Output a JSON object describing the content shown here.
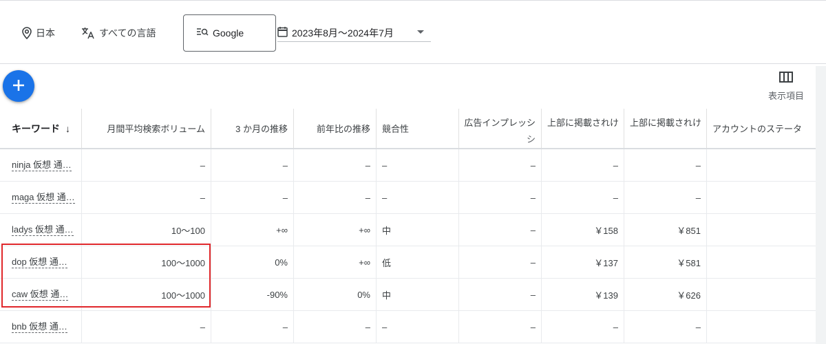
{
  "filters": {
    "location_icon": "location-pin-icon",
    "location": "日本",
    "language_icon": "translate-icon",
    "language": "すべての言語",
    "engine_icon": "search-engine-icon",
    "engine": "Google",
    "date_icon": "calendar-icon",
    "date_range": "2023年8月～2024年7月"
  },
  "toolbar": {
    "add_icon": "plus-icon",
    "columns_icon": "columns-icon",
    "columns_label": "表示項目"
  },
  "table": {
    "headers": {
      "keyword": "キーワード",
      "sort_arrow": "↓",
      "volume": "月間平均検索ボリューム",
      "trend3m": "3 か月の推移",
      "yoy": "前年比の推移",
      "competition": "競合性",
      "impression_share": "広告インプレッシ",
      "impression_share_cont": "シ",
      "top_bid_low": "上部に掲載されけ",
      "top_bid_high": "上部に掲載されけ",
      "account_status": "アカウントのステータ"
    },
    "rows": [
      {
        "keyword": "ninja 仮想 通…",
        "volume": "–",
        "trend3m": "–",
        "yoy": "–",
        "competition": "–",
        "impression_share": "–",
        "top_bid_low": "–",
        "top_bid_high": "–",
        "account_status": ""
      },
      {
        "keyword": "maga 仮想 通…",
        "volume": "–",
        "trend3m": "–",
        "yoy": "–",
        "competition": "–",
        "impression_share": "–",
        "top_bid_low": "–",
        "top_bid_high": "–",
        "account_status": ""
      },
      {
        "keyword": "ladys 仮想 通…",
        "volume": "10～100",
        "trend3m": "+∞",
        "yoy": "+∞",
        "competition": "中",
        "impression_share": "–",
        "top_bid_low": "￥158",
        "top_bid_high": "￥851",
        "account_status": ""
      },
      {
        "keyword": "dop 仮想 通…",
        "volume": "100～1000",
        "trend3m": "0%",
        "yoy": "+∞",
        "competition": "低",
        "impression_share": "–",
        "top_bid_low": "￥137",
        "top_bid_high": "￥581",
        "account_status": ""
      },
      {
        "keyword": "caw 仮想 通…",
        "volume": "100～1000",
        "trend3m": "-90%",
        "yoy": "0%",
        "competition": "中",
        "impression_share": "–",
        "top_bid_low": "￥139",
        "top_bid_high": "￥626",
        "account_status": ""
      },
      {
        "keyword": "bnb 仮想 通…",
        "volume": "–",
        "trend3m": "–",
        "yoy": "–",
        "competition": "–",
        "impression_share": "–",
        "top_bid_low": "–",
        "top_bid_high": "–",
        "account_status": ""
      }
    ]
  },
  "colors": {
    "accent": "#1a73e8",
    "highlight_border": "#e0262a"
  }
}
